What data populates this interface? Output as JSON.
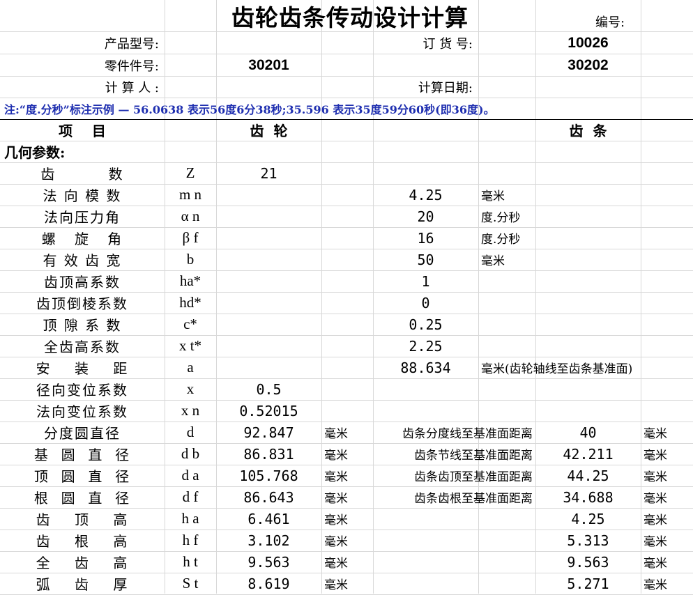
{
  "title": "齿轮齿条传动设计计算",
  "number_label": "编号:",
  "product_model_label": "产品型号:",
  "order_no_label": "订 货 号:",
  "order_no_value": "10026",
  "part_no_label": "零件件号:",
  "part_no_gear": "30201",
  "part_no_rack": "30202",
  "calculator_label": "计 算 人 :",
  "calc_date_label": "计算日期:",
  "note": "注:“度.分秒”标注示例 — 56.0638 表示56度6分38秒;35.596 表示35度59分60秒(即36度)。",
  "header": {
    "item": "项    目",
    "gear": "齿  轮",
    "rack": "齿  条"
  },
  "section_geometry": "几何参数:",
  "rows": [
    {
      "name": "齿         数",
      "sym": "Z",
      "g": "21",
      "gu": "",
      "mid": "",
      "mu": "",
      "r": "",
      "ru": ""
    },
    {
      "name": "法 向 模 数",
      "sym": "m n",
      "g": "",
      "gu": "",
      "mid": "4.25",
      "mu": "毫米",
      "r": "",
      "ru": ""
    },
    {
      "name": "法向压力角",
      "sym": "α n",
      "g": "",
      "gu": "",
      "mid": "20",
      "mu": "度.分秒",
      "r": "",
      "ru": ""
    },
    {
      "name": "螺   旋   角",
      "sym": "β f",
      "g": "",
      "gu": "",
      "mid": "16",
      "mu": "度.分秒",
      "r": "",
      "ru": ""
    },
    {
      "name": "有 效 齿 宽",
      "sym": "b",
      "g": "",
      "gu": "",
      "mid": "50",
      "mu": "毫米",
      "r": "",
      "ru": ""
    },
    {
      "name": "齿顶高系数",
      "sym": "ha*",
      "g": "",
      "gu": "",
      "mid": "1",
      "mu": "",
      "r": "",
      "ru": ""
    },
    {
      "name": "齿顶倒棱系数",
      "sym": "hd*",
      "g": "",
      "gu": "",
      "mid": "0",
      "mu": "",
      "r": "",
      "ru": ""
    },
    {
      "name": "顶 隙 系 数",
      "sym": "c*",
      "g": "",
      "gu": "",
      "mid": "0.25",
      "mu": "",
      "r": "",
      "ru": ""
    },
    {
      "name": "全齿高系数",
      "sym": "x t*",
      "g": "",
      "gu": "",
      "mid": "2.25",
      "mu": "",
      "r": "",
      "ru": ""
    },
    {
      "name": "安    装    距",
      "sym": "a",
      "g": "",
      "gu": "",
      "mid": "88.634",
      "mu": "毫米(齿轮轴线至齿条基准面)",
      "r": "",
      "ru": ""
    },
    {
      "name": "径向变位系数",
      "sym": "x",
      "g": "0.5",
      "gu": "",
      "mid": "",
      "mu": "",
      "r": "",
      "ru": ""
    },
    {
      "name": "法向变位系数",
      "sym": "x n",
      "g": "0.52015",
      "gu": "",
      "mid": "",
      "mu": "",
      "r": "",
      "ru": ""
    },
    {
      "name": "分度圆直径",
      "sym": "d",
      "g": "92.847",
      "gu": "毫米",
      "mid": "齿条分度线至基准面距离",
      "mu": "",
      "r": "40",
      "ru": "毫米"
    },
    {
      "name": "基  圆  直  径",
      "sym": "d b",
      "g": "86.831",
      "gu": "毫米",
      "mid": "齿条节线至基准面距离",
      "mu": "",
      "r": "42.211",
      "ru": "毫米"
    },
    {
      "name": "顶  圆  直  径",
      "sym": "d a",
      "g": "105.768",
      "gu": "毫米",
      "mid": "齿条齿顶至基准面距离",
      "mu": "",
      "r": "44.25",
      "ru": "毫米"
    },
    {
      "name": "根  圆  直  径",
      "sym": "d f",
      "g": "86.643",
      "gu": "毫米",
      "mid": "齿条齿根至基准面距离",
      "mu": "",
      "r": "34.688",
      "ru": "毫米"
    },
    {
      "name": "齿    顶    高",
      "sym": "h a",
      "g": "6.461",
      "gu": "毫米",
      "mid": "",
      "mu": "",
      "r": "4.25",
      "ru": "毫米"
    },
    {
      "name": "齿    根    高",
      "sym": "h f",
      "g": "3.102",
      "gu": "毫米",
      "mid": "",
      "mu": "",
      "r": "5.313",
      "ru": "毫米"
    },
    {
      "name": "全    齿    高",
      "sym": "h t",
      "g": "9.563",
      "gu": "毫米",
      "mid": "",
      "mu": "",
      "r": "9.563",
      "ru": "毫米"
    },
    {
      "name": "弧    齿    厚",
      "sym": "S t",
      "g": "8.619",
      "gu": "毫米",
      "mid": "",
      "mu": "",
      "r": "5.271",
      "ru": "毫米"
    }
  ]
}
